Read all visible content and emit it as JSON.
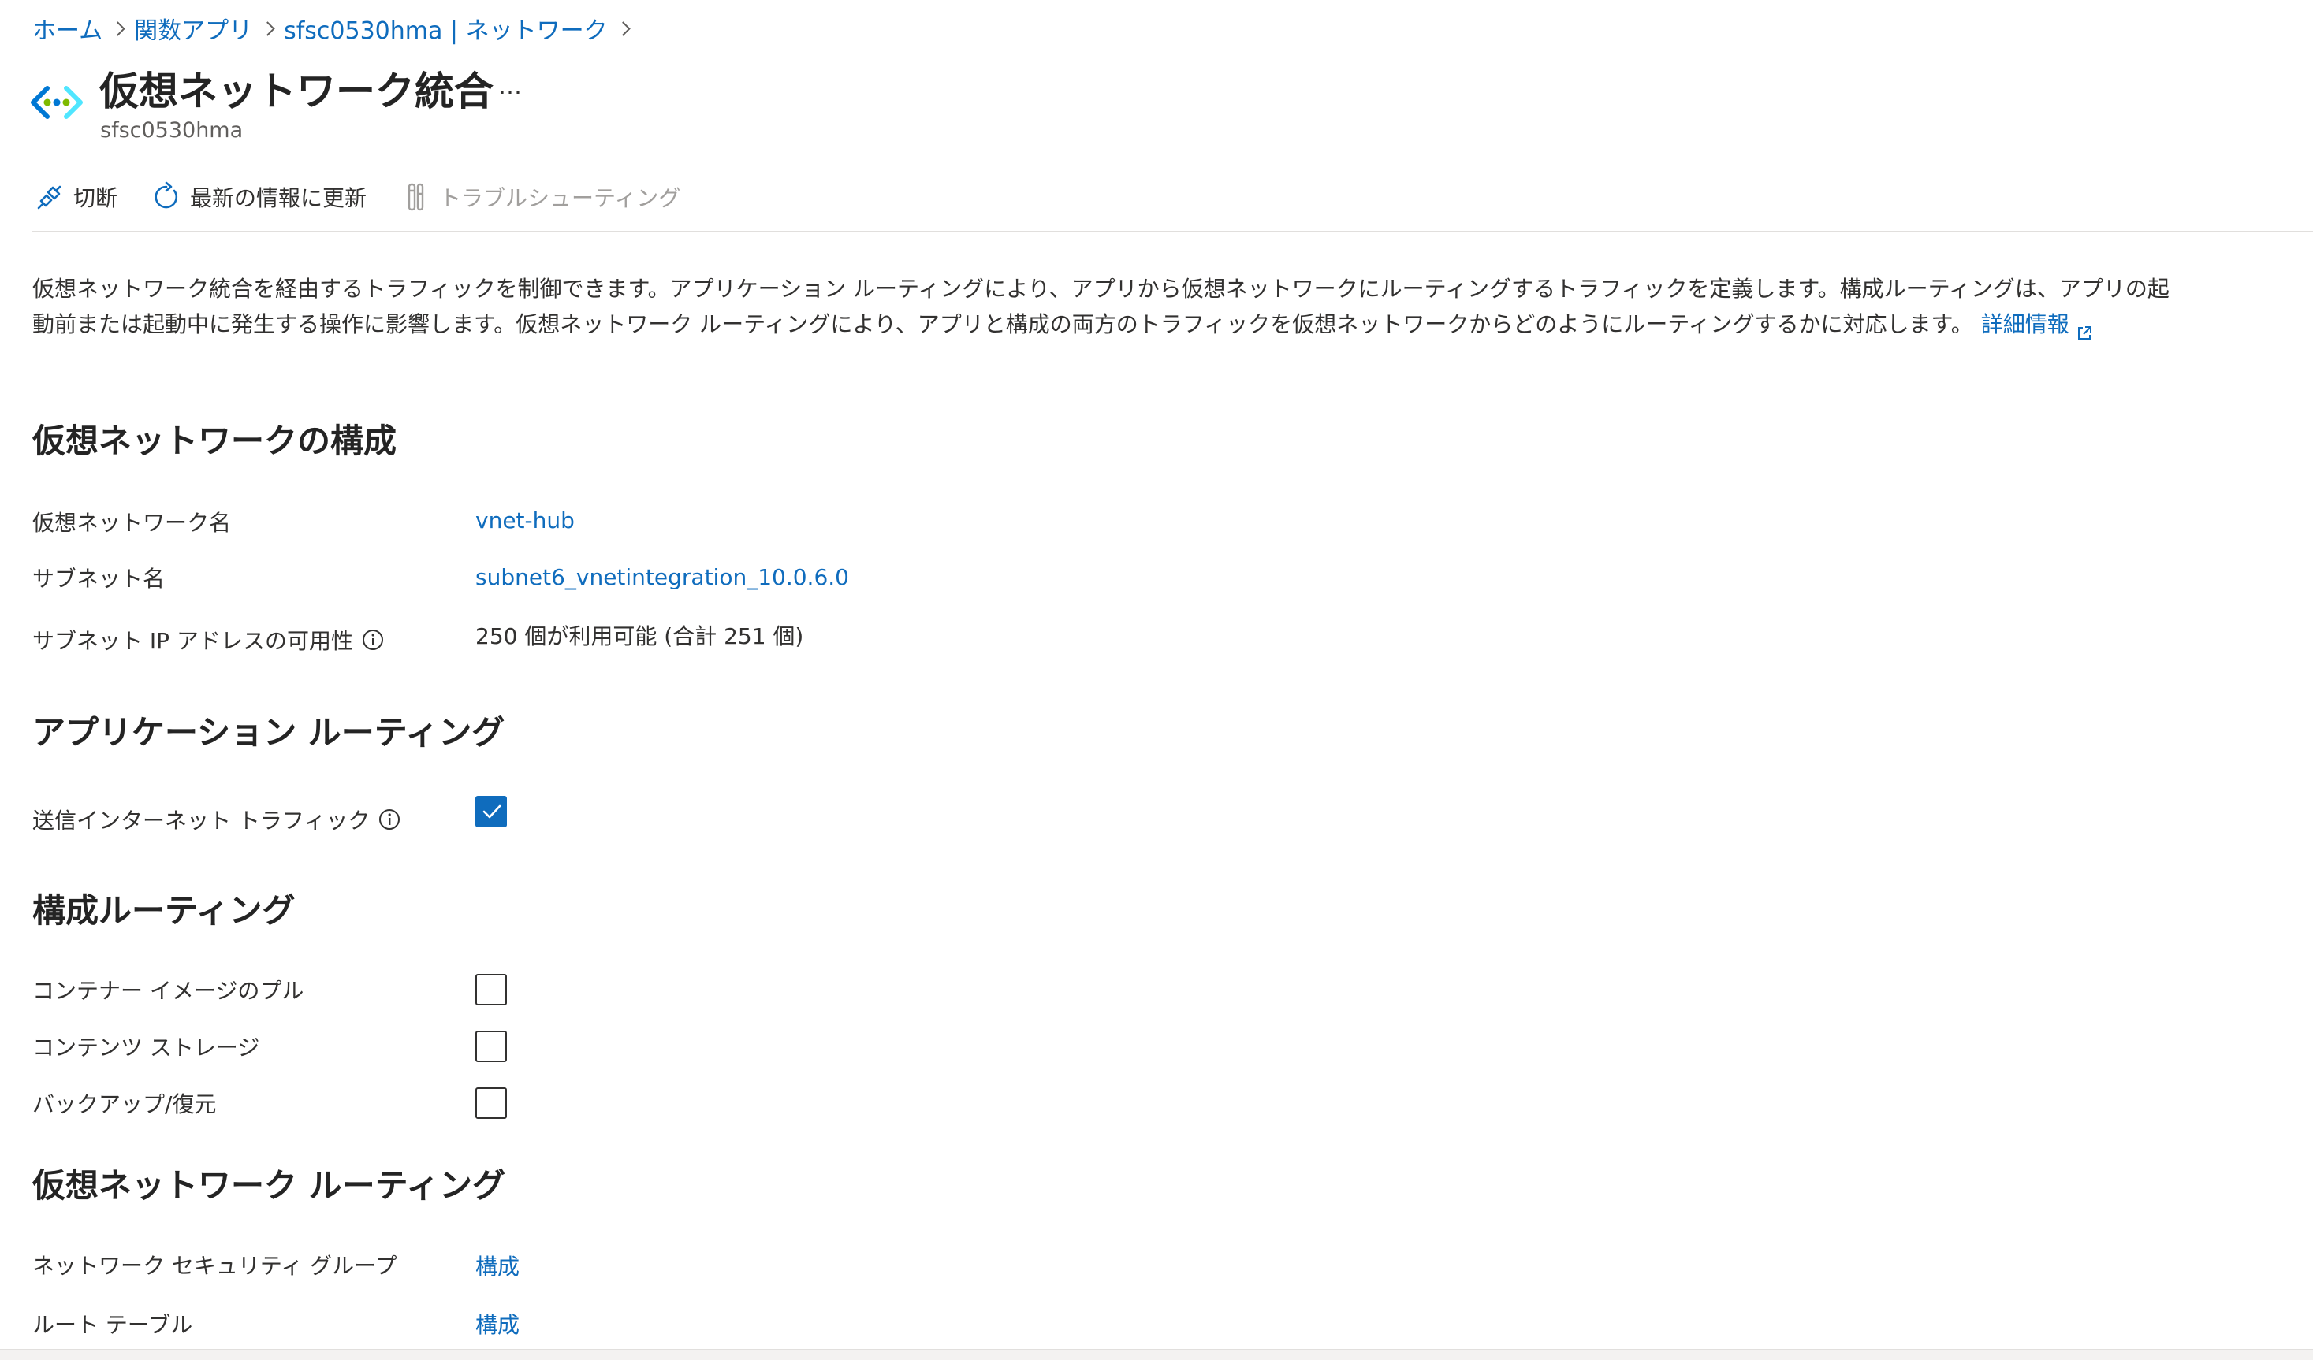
{
  "breadcrumb": {
    "items": [
      "ホーム",
      "関数アプリ",
      "sfsc0530hma | ネットワーク"
    ]
  },
  "header": {
    "title": "仮想ネットワーク統合",
    "more": "…",
    "subtitle": "sfsc0530hma",
    "icon": "vnet-integration-icon"
  },
  "toolbar": {
    "disconnect": "切断",
    "refresh": "最新の情報に更新",
    "troubleshoot": "トラブルシューティング"
  },
  "description": {
    "text": "仮想ネットワーク統合を経由するトラフィックを制御できます。アプリケーション ルーティングにより、アプリから仮想ネットワークにルーティングするトラフィックを定義します。構成ルーティングは、アプリの起動前または起動中に発生する操作に影響します。仮想ネットワーク ルーティングにより、アプリと構成の両方のトラフィックを仮想ネットワークからどのようにルーティングするかに対応します。",
    "link": "詳細情報"
  },
  "vnet_config": {
    "title": "仮想ネットワークの構成",
    "vnet_name_label": "仮想ネットワーク名",
    "vnet_name_value": "vnet-hub",
    "subnet_name_label": "サブネット名",
    "subnet_name_value": "subnet6_vnetintegration_10.0.6.0",
    "ip_availability_label": "サブネット IP アドレスの可用性",
    "ip_availability_value": "250 個が利用可能 (合計 251 個)"
  },
  "app_routing": {
    "title": "アプリケーション ルーティング",
    "outbound_label": "送信インターネット トラフィック",
    "outbound_checked": true
  },
  "config_routing": {
    "title": "構成ルーティング",
    "items": [
      {
        "label": "コンテナー イメージのプル",
        "checked": false
      },
      {
        "label": "コンテンツ ストレージ",
        "checked": false
      },
      {
        "label": "バックアップ/復元",
        "checked": false
      }
    ]
  },
  "vnet_routing": {
    "title": "仮想ネットワーク ルーティング",
    "nsg_label": "ネットワーク セキュリティ グループ",
    "nsg_value": "構成",
    "route_table_label": "ルート テーブル",
    "route_table_value": "構成"
  },
  "colors": {
    "accent": "#0f6cbd",
    "text": "#323130",
    "muted": "#605e5c",
    "disabled": "#a19f9d"
  }
}
